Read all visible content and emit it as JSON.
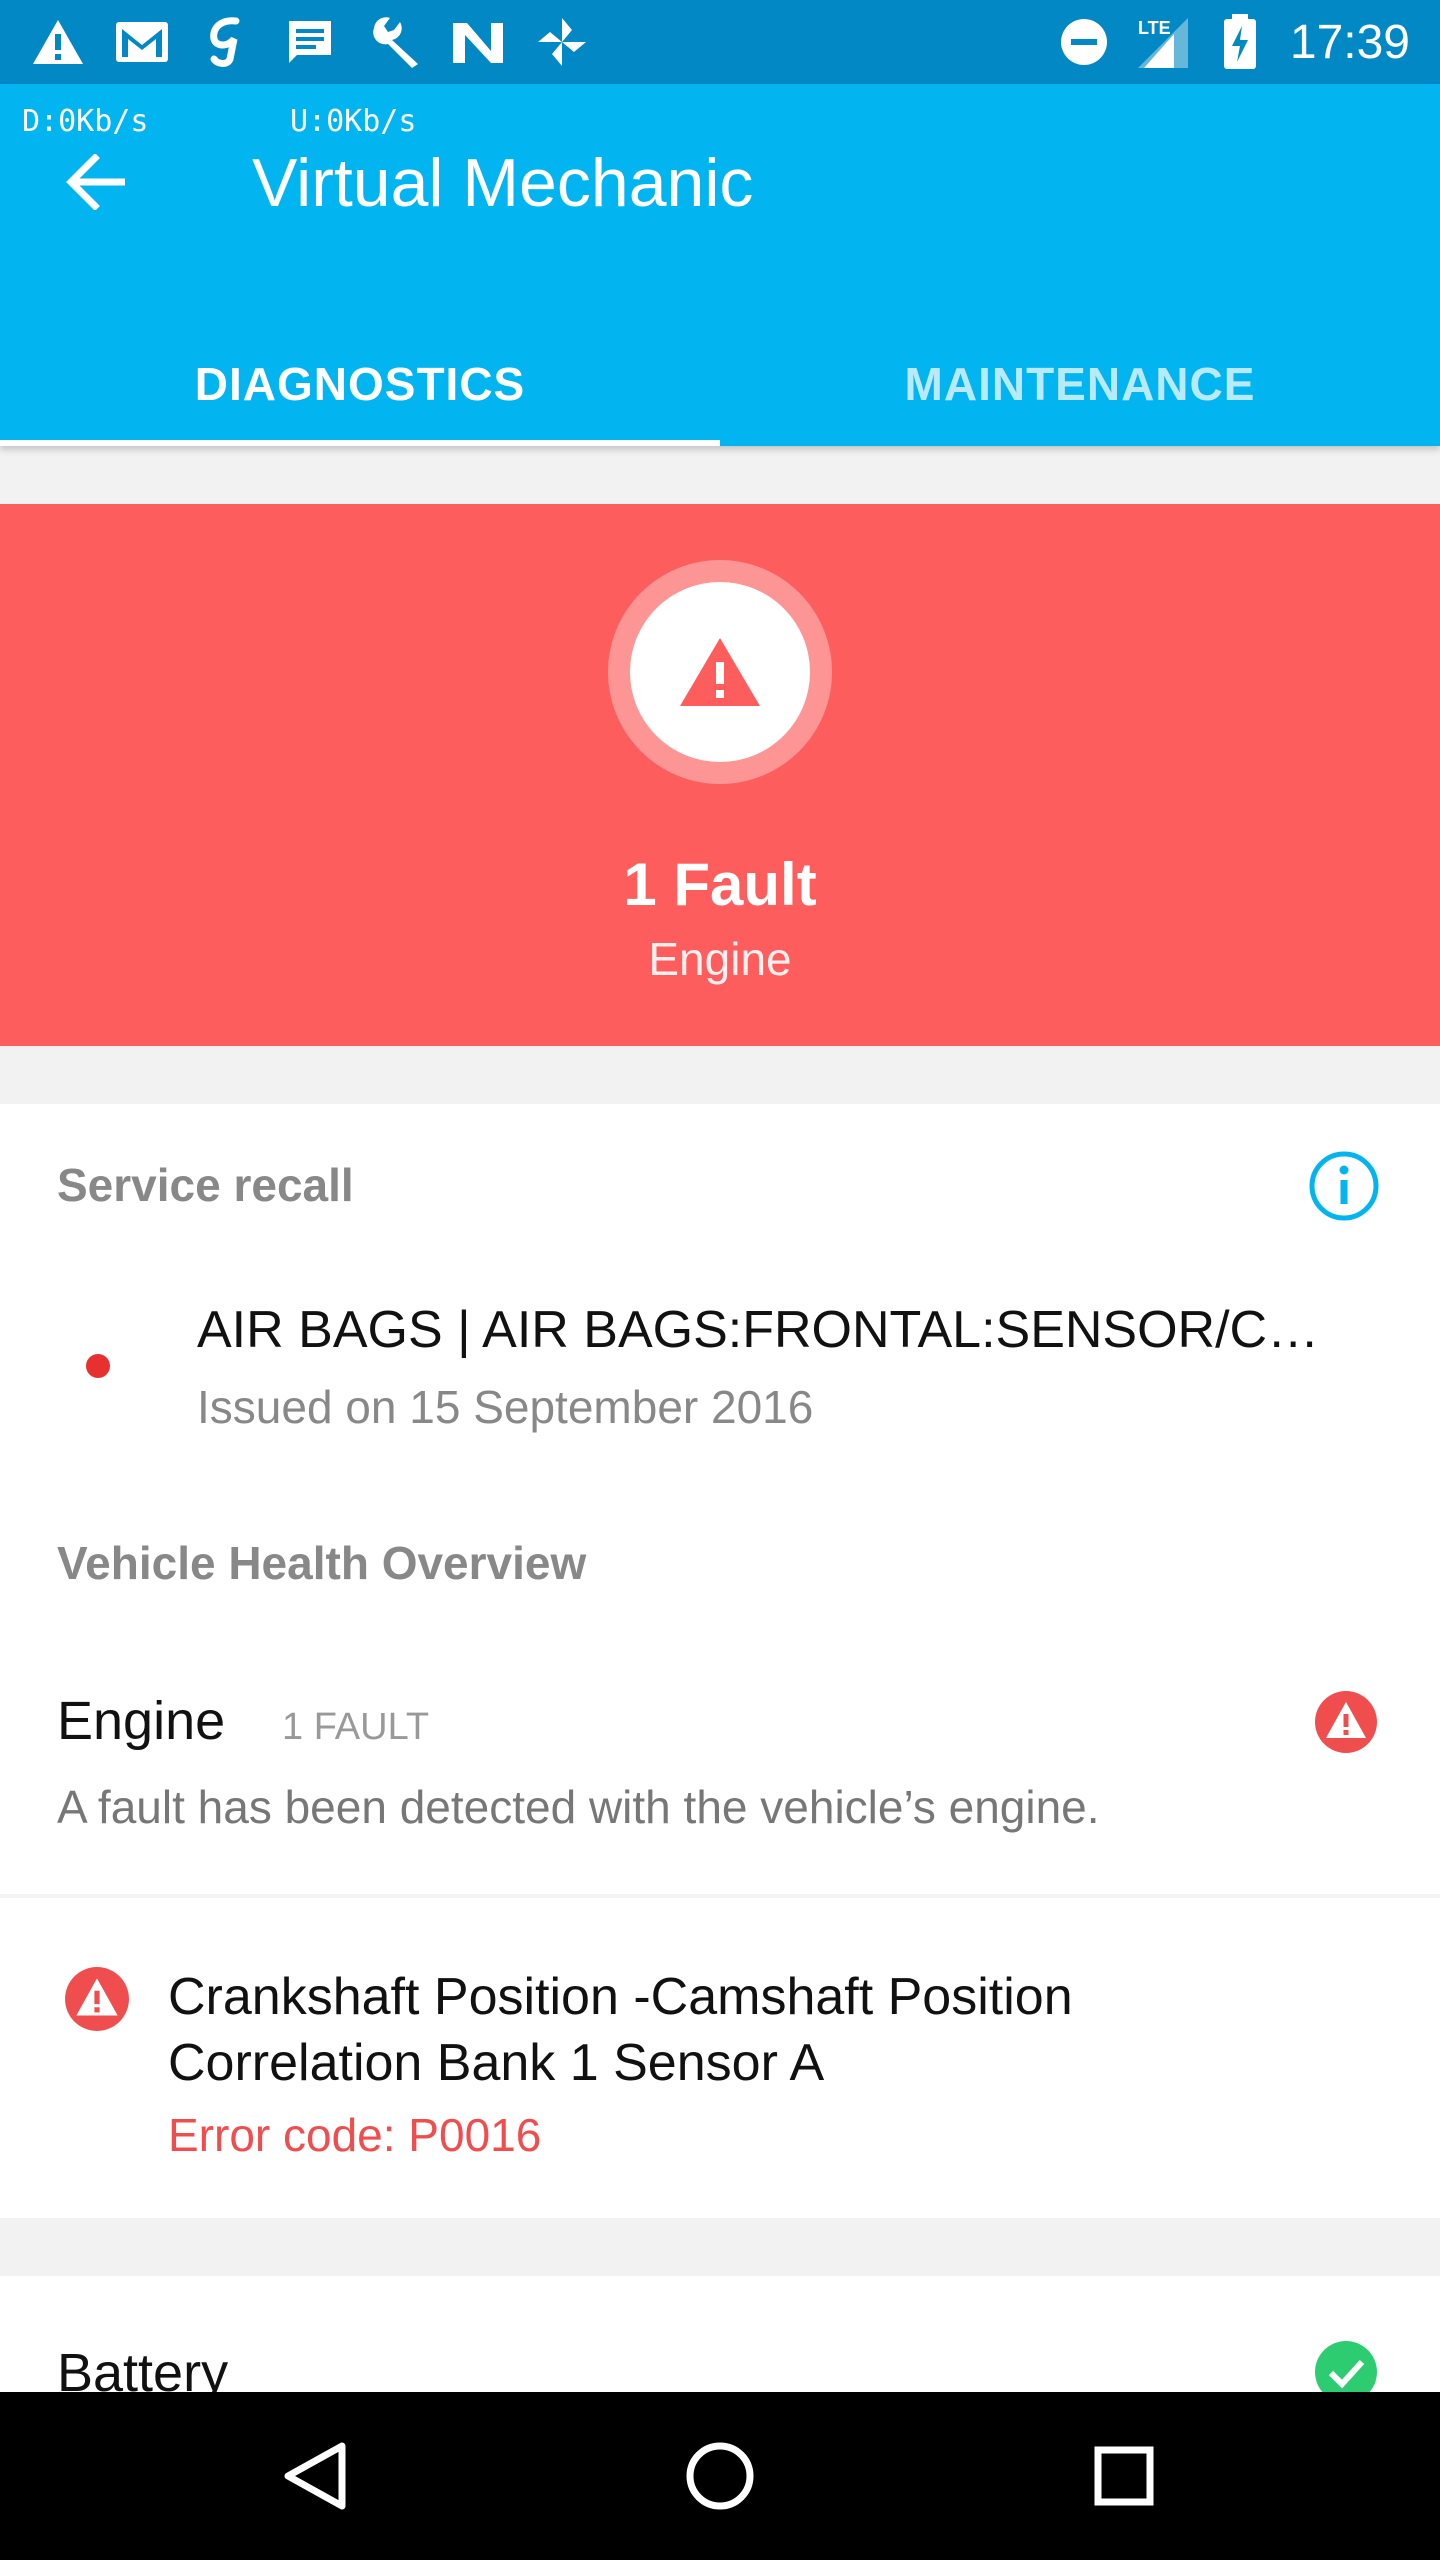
{
  "status_bar": {
    "time": "17:39",
    "left_icons": [
      "warning-icon",
      "gmail-icon",
      "g-app-icon",
      "message-icon",
      "wrench-icon",
      "n-app-icon",
      "pinwheel-icon"
    ],
    "right_icons": [
      "do-not-disturb-icon",
      "lte-signal-icon",
      "battery-charging-icon"
    ],
    "lte_label": "LTE"
  },
  "app_bar": {
    "download_speed": "D:0Kb/s",
    "upload_speed": "U:0Kb/s",
    "title": "Virtual Mechanic"
  },
  "tabs": [
    {
      "label": "DIAGNOSTICS",
      "active": true
    },
    {
      "label": "MAINTENANCE",
      "active": false
    }
  ],
  "fault_banner": {
    "title": "1 Fault",
    "subtitle": "Engine",
    "color": "#fd5d5d"
  },
  "service_recall": {
    "heading": "Service recall",
    "item_title": "AIR BAGS | AIR BAGS:FRONTAL:SENSOR/CONTROL MODULE",
    "item_date": "Issued on 15 September 2016"
  },
  "health_overview": {
    "heading": "Vehicle Health Overview",
    "engine": {
      "name": "Engine",
      "count": "1 FAULT",
      "description": "A fault has been detected with the vehicle’s engine."
    },
    "engine_fault": {
      "title_line1": "Crankshaft Position -Camshaft Position",
      "title_line2": "Correlation Bank 1 Sensor A",
      "error_code": "Error code: P0016"
    },
    "battery": {
      "name": "Battery"
    }
  },
  "colors": {
    "primary": "#02b5f0",
    "status_bar": "#0288c4",
    "fault": "#fd5d5d",
    "ok": "#2ecc71",
    "error_text": "#f04e4e"
  }
}
